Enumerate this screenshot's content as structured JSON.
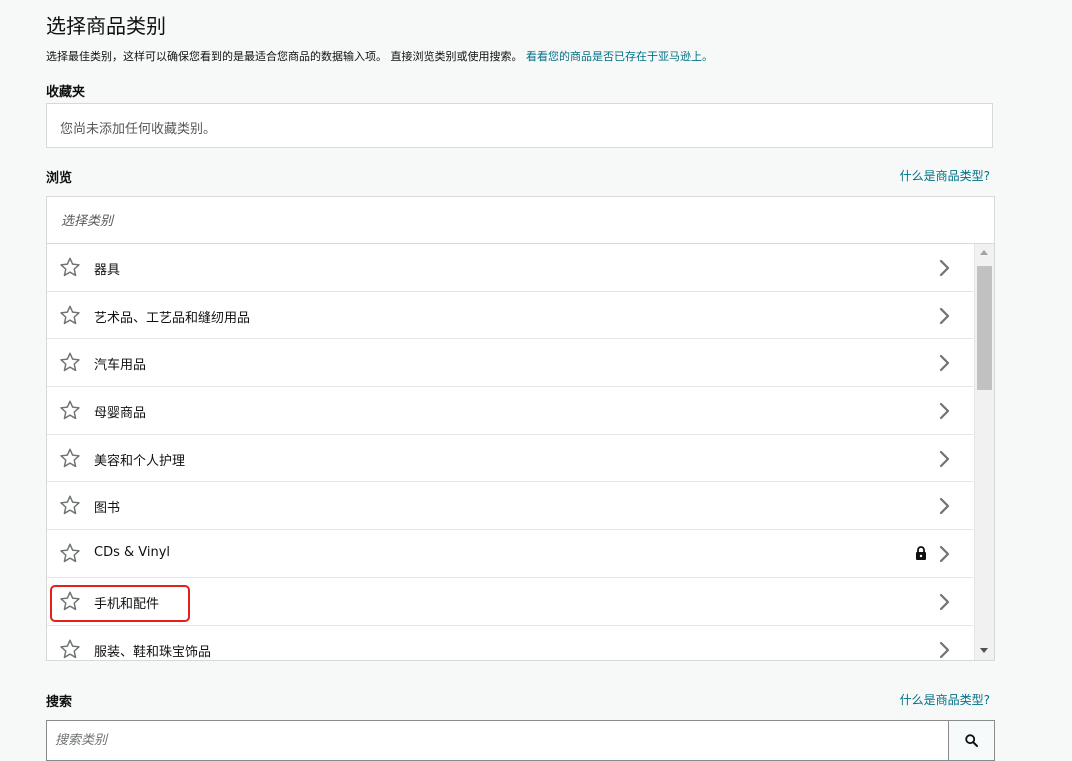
{
  "page": {
    "title": "选择商品类别",
    "description": "选择最佳类别，这样可以确保您看到的是最适合您商品的数据输入项。 直接浏览类别或使用搜索。",
    "description_link": "看看您的商品是否已存在于亚马逊上。"
  },
  "favorites": {
    "label": "收藏夹",
    "empty_text": "您尚未添加任何收藏类别。"
  },
  "browse": {
    "label": "浏览",
    "help_link": "什么是商品类型?",
    "header": "选择类别",
    "items": [
      {
        "label": "器具",
        "icon": "star-outline-icon",
        "locked": false
      },
      {
        "label": "艺术品、工艺品和缝纫用品",
        "icon": "star-outline-icon",
        "locked": false
      },
      {
        "label": "汽车用品",
        "icon": "star-outline-icon",
        "locked": false
      },
      {
        "label": "母婴商品",
        "icon": "star-outline-icon",
        "locked": false
      },
      {
        "label": "美容和个人护理",
        "icon": "star-outline-icon",
        "locked": false
      },
      {
        "label": "图书",
        "icon": "star-outline-icon",
        "locked": false
      },
      {
        "label": "CDs & Vinyl",
        "icon": "star-outline-icon",
        "locked": true
      },
      {
        "label": "手机和配件",
        "icon": "star-outline-icon",
        "locked": false
      },
      {
        "label": "服装、鞋和珠宝饰品",
        "icon": "star-outline-icon",
        "locked": false
      }
    ]
  },
  "search": {
    "label": "搜索",
    "help_link": "什么是商品类型?",
    "placeholder": "搜索类别",
    "button_icon": "search-icon"
  },
  "colors": {
    "link": "#007185",
    "highlight": "#e0201b",
    "background": "#f7f8f8"
  }
}
